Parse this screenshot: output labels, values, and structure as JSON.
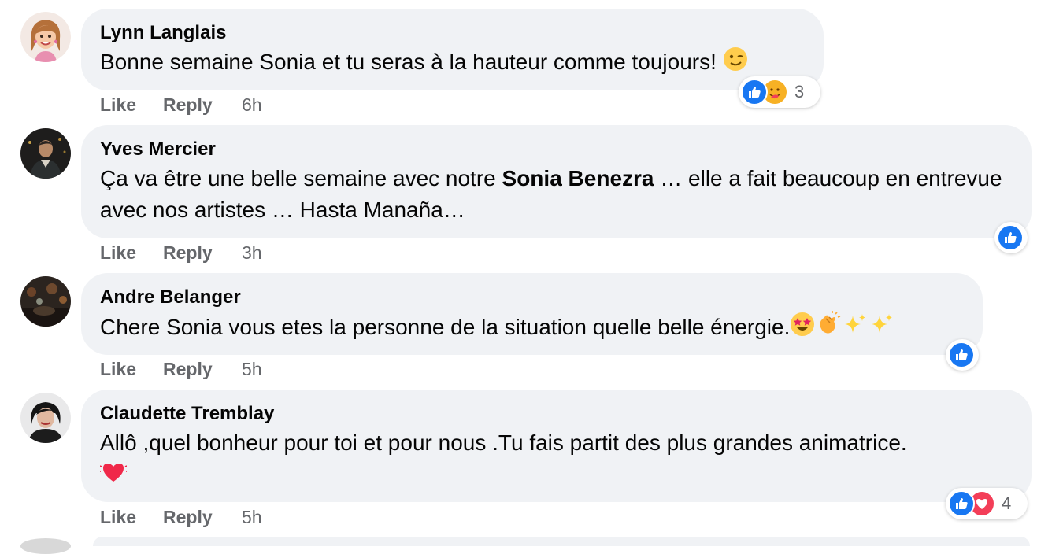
{
  "labels": {
    "like": "Like",
    "reply": "Reply"
  },
  "colors": {
    "bubble": "#f0f2f5",
    "meta_text": "#65676b",
    "like_blue": "#1877f2",
    "love_red": "#f33e58",
    "care_yellow": "#f7b125"
  },
  "comments": [
    {
      "author": "Lynn Langlais",
      "text": "Bonne semaine Sonia et tu seras à la hauteur comme toujours!",
      "emoji": "wink-emoji",
      "time": "6h",
      "reactions": [
        "like",
        "care"
      ],
      "reaction_count": "3"
    },
    {
      "author": "Yves Mercier",
      "text_before": "Ça va être une belle semaine avec notre ",
      "mention": "Sonia Benezra",
      "text_after": " … elle a fait beaucoup en entrevue avec nos artistes … Hasta Manaña…",
      "time": "3h",
      "reactions": [
        "like"
      ]
    },
    {
      "author": "Andre Belanger",
      "text": "Chere Sonia vous etes la personne de la situation quelle belle énergie.",
      "emojis": [
        "star-struck-emoji",
        "clapping-hands-emoji",
        "sparkles-emoji",
        "sparkles-emoji"
      ],
      "time": "5h",
      "reactions": [
        "like"
      ]
    },
    {
      "author": "Claudette Tremblay",
      "text": "Allô ,quel bonheur pour toi et pour nous .Tu fais partit des plus grandes animatrice.",
      "emoji": "beating-heart-emoji",
      "time": "5h",
      "reactions": [
        "like",
        "love"
      ],
      "reaction_count": "4"
    }
  ]
}
